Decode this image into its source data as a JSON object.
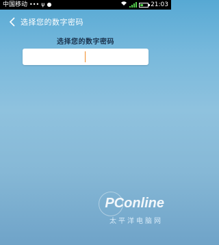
{
  "status_bar": {
    "carrier": "中国移动",
    "time": "21:03",
    "battery_level": 0.35,
    "icons": [
      "dots-icon",
      "usb-icon",
      "qq-icon",
      "wifi-icon",
      "signal-icon",
      "battery-icon"
    ]
  },
  "header": {
    "title": "选择您的数字密码"
  },
  "main": {
    "prompt": "选择您的数字密码",
    "pin_value": ""
  },
  "watermark": {
    "brand": "PConline",
    "sub": "太平洋电脑网"
  },
  "colors": {
    "accent_cursor": "#f28c28",
    "status_green": "#56d04f"
  }
}
